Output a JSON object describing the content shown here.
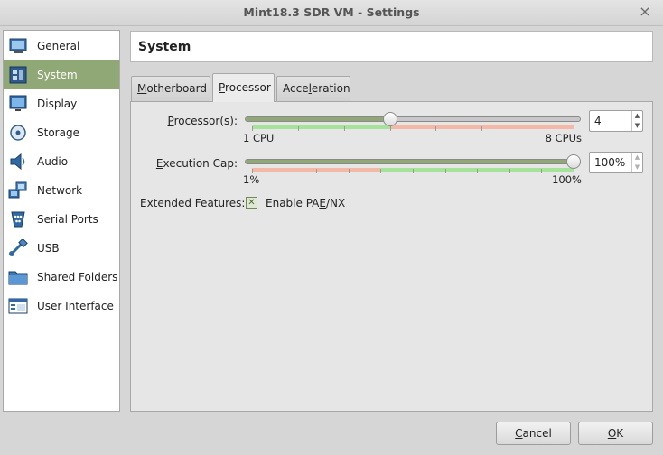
{
  "window": {
    "title": "Mint18.3 SDR VM - Settings",
    "close_glyph": "×"
  },
  "sidebar": {
    "items": [
      {
        "label": "General",
        "icon": "general-icon",
        "selected": false
      },
      {
        "label": "System",
        "icon": "system-icon",
        "selected": true
      },
      {
        "label": "Display",
        "icon": "display-icon",
        "selected": false
      },
      {
        "label": "Storage",
        "icon": "storage-icon",
        "selected": false
      },
      {
        "label": "Audio",
        "icon": "audio-icon",
        "selected": false
      },
      {
        "label": "Network",
        "icon": "network-icon",
        "selected": false
      },
      {
        "label": "Serial Ports",
        "icon": "serial-ports-icon",
        "selected": false
      },
      {
        "label": "USB",
        "icon": "usb-icon",
        "selected": false
      },
      {
        "label": "Shared Folders",
        "icon": "shared-folders-icon",
        "selected": false
      },
      {
        "label": "User Interface",
        "icon": "user-interface-icon",
        "selected": false
      }
    ],
    "selected_color": "#8fa876"
  },
  "page": {
    "title": "System"
  },
  "tabs": [
    {
      "pre": "",
      "acc": "M",
      "post": "otherboard",
      "active": false
    },
    {
      "pre": "",
      "acc": "P",
      "post": "rocessor",
      "active": true
    },
    {
      "pre": "Acce",
      "acc": "l",
      "post": "eration",
      "active": false
    }
  ],
  "processor": {
    "label_pre": "",
    "label_acc": "P",
    "label_post": "rocessor(s):",
    "value": "4",
    "min_label": "1 CPU",
    "max_label": "8 CPUs",
    "min": 1,
    "max": 8,
    "current": 4,
    "recommended_max": 4
  },
  "execution_cap": {
    "label_pre": "",
    "label_acc": "E",
    "label_post": "xecution Cap:",
    "value": "100%",
    "min_label": "1%",
    "max_label": "100%",
    "min": 1,
    "max": 100,
    "current": 100
  },
  "extended_features": {
    "label": "Extended Features:",
    "checkbox_pre": "Enable PA",
    "checkbox_acc": "E",
    "checkbox_post": "/NX",
    "checked": true
  },
  "buttons": {
    "cancel_acc": "C",
    "cancel_post": "ancel",
    "ok_acc": "O",
    "ok_post": "K"
  },
  "colors": {
    "accent": "#8fa876",
    "good_band": "#a6e39a",
    "bad_band": "#f3b8a6"
  }
}
